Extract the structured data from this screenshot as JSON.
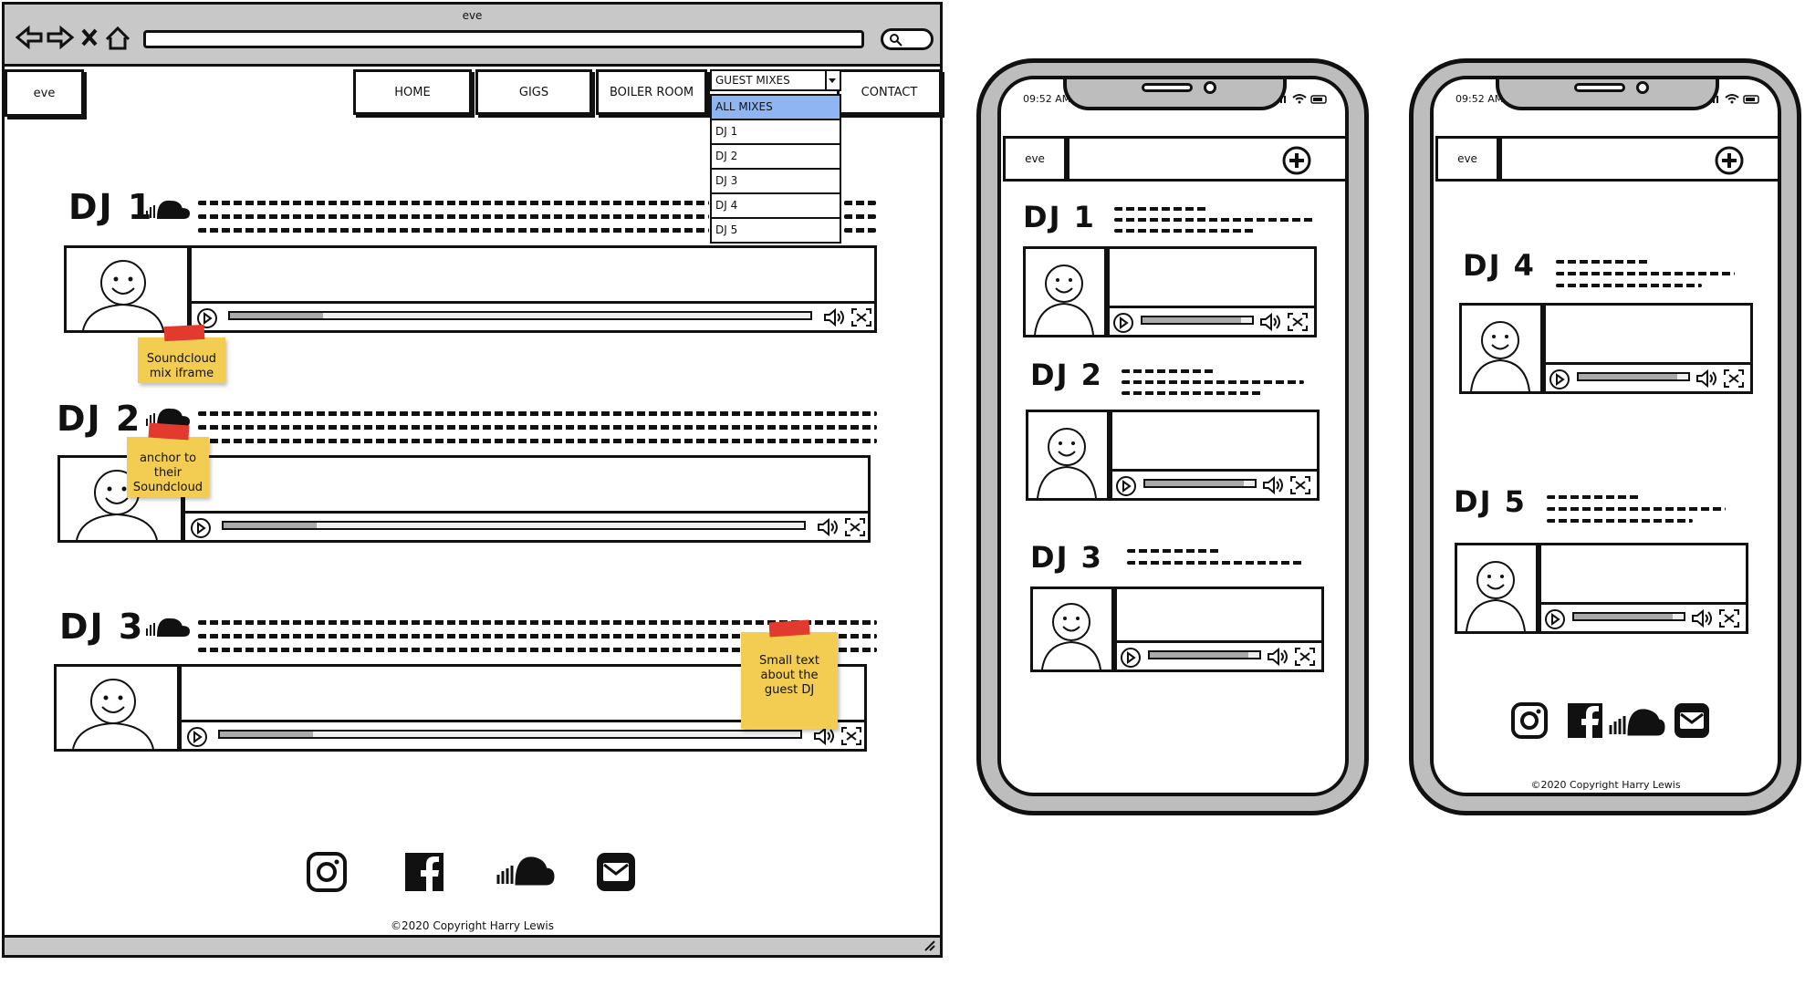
{
  "browser": {
    "title": "eve",
    "nav_icons": [
      "back-arrow-icon",
      "forward-arrow-icon",
      "close-icon",
      "home-icon"
    ],
    "search_icon": "search-icon"
  },
  "desktop": {
    "logo": "eve",
    "nav": {
      "home": "HOME",
      "gigs": "GIGS",
      "boiler_room": "BOILER ROOM",
      "guest_mixes": "GUEST MIXES",
      "contact": "CONTACT"
    },
    "dropdown": [
      "ALL MIXES",
      "DJ 1",
      "DJ 2",
      "DJ 3",
      "DJ 4",
      "DJ 5"
    ],
    "dropdown_selected_color": "#8fb6f2",
    "djs": [
      {
        "name": "DJ 1"
      },
      {
        "name": "DJ 2"
      },
      {
        "name": "DJ 3"
      }
    ],
    "notes": {
      "iframe": "Soundcloud mix iframe",
      "anchor": "anchor to their Soundcloud",
      "small_text": "Small text about the guest DJ"
    },
    "footer": "©2020 Copyright Harry Lewis",
    "social_icons": [
      "instagram-icon",
      "facebook-icon",
      "soundcloud-icon",
      "email-icon"
    ]
  },
  "phone1": {
    "time": "09:52 AM",
    "logo": "eve",
    "djs": [
      {
        "name": "DJ 1"
      },
      {
        "name": "DJ 2"
      },
      {
        "name": "DJ 3"
      }
    ]
  },
  "phone2": {
    "time": "09:52 AM",
    "logo": "eve",
    "djs": [
      {
        "name": "DJ 4"
      },
      {
        "name": "DJ 5"
      }
    ],
    "footer": "©2020 Copyright Harry Lewis"
  },
  "colors": {
    "note": "#f3cd52",
    "tape": "#e23a2e",
    "chrome": "#c8c8c8"
  }
}
